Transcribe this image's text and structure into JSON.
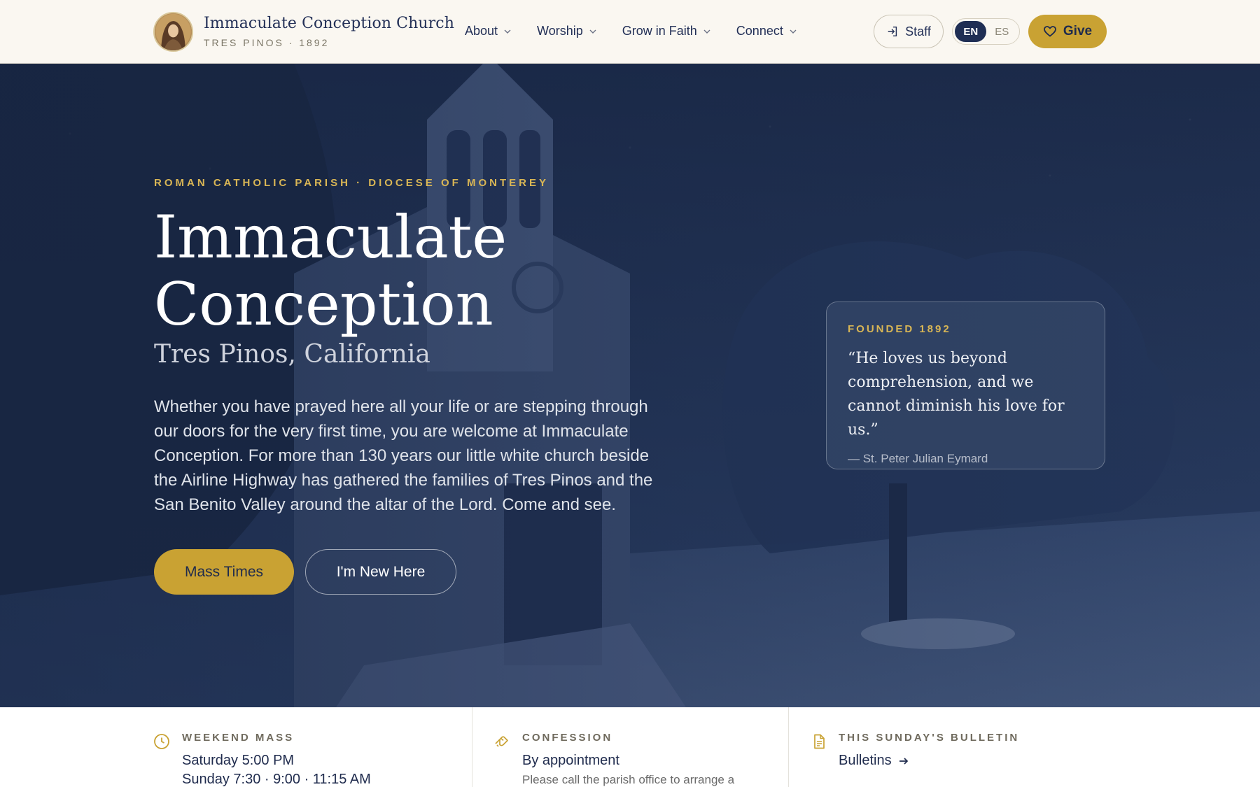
{
  "header": {
    "brand_title": "Immaculate Conception Church",
    "brand_subtitle": "TRES PINOS · 1892",
    "nav": [
      {
        "label": "About"
      },
      {
        "label": "Worship"
      },
      {
        "label": "Grow in Faith"
      },
      {
        "label": "Connect"
      }
    ],
    "staff_label": "Staff",
    "lang_active": "EN",
    "lang_other": "ES",
    "give_label": "Give"
  },
  "hero": {
    "eyebrow": "ROMAN CATHOLIC PARISH · DIOCESE OF MONTEREY",
    "title_line1": "Immaculate",
    "title_line2": "Conception",
    "subtitle": "Tres Pinos, California",
    "description": "Whether you have prayed here all your life or are stepping through our doors for the very first time, you are welcome at Immaculate Conception. For more than 130 years our little white church beside the Airline Highway has gathered the families of Tres Pinos and the San Benito Valley around the altar of the Lord. Come and see.",
    "primary_button": "Mass Times",
    "secondary_button": "I'm New Here",
    "quote_card": {
      "eyebrow": "FOUNDED 1892",
      "quote": "“He loves us beyond comprehension, and we cannot diminish his love for us.”",
      "author": "— St. Peter Julian Eymard"
    }
  },
  "info": {
    "weekend_mass": {
      "label": "WEEKEND MASS",
      "line1": "Saturday 5:00 PM",
      "line2": "Sunday 7:30 · 9:00 · 11:15 AM"
    },
    "confession": {
      "label": "CONFESSION",
      "value": "By appointment",
      "note": "Please call the parish office to arrange a"
    },
    "bulletin": {
      "label": "THIS SUNDAY'S BULLETIN",
      "link": "Bulletins"
    }
  },
  "colors": {
    "navy": "#1f2b4d",
    "gold": "#c9a233",
    "cream": "#faf7f1"
  }
}
